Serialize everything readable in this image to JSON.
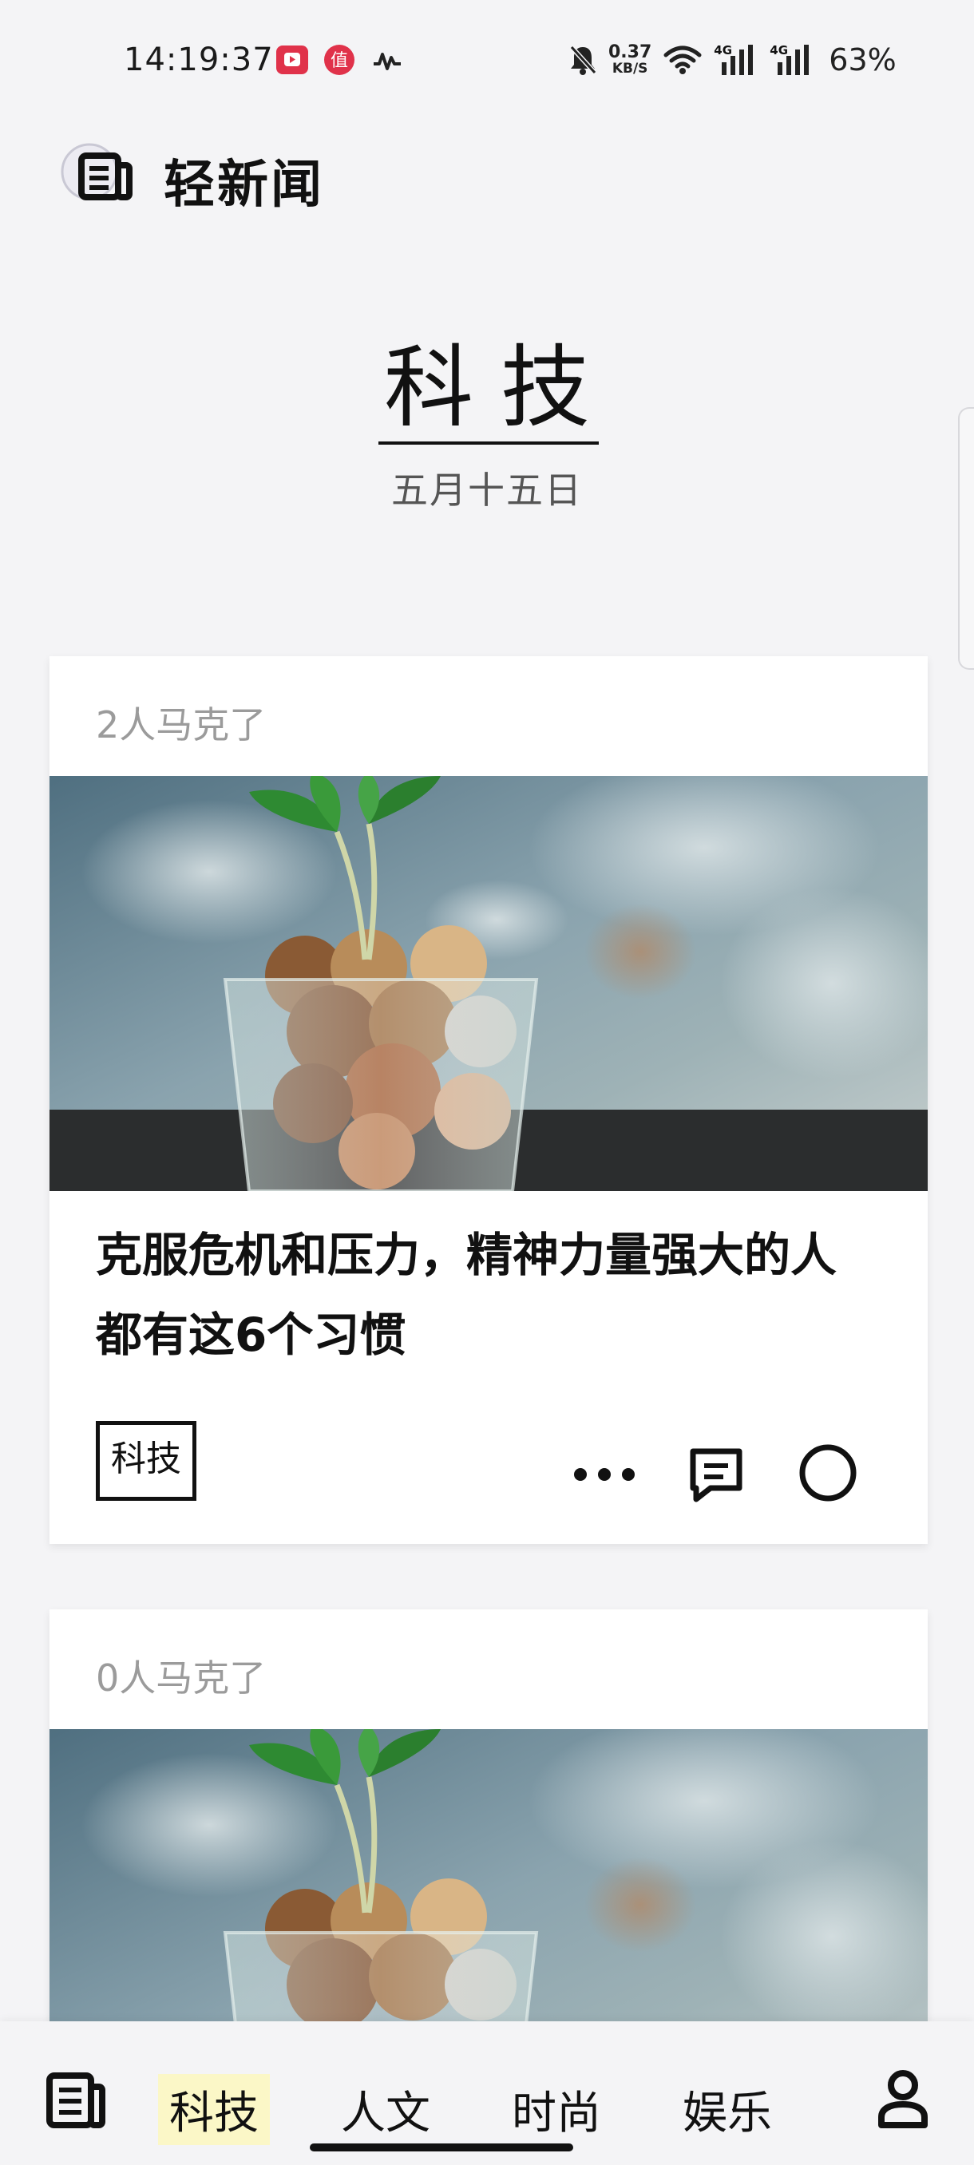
{
  "status_bar": {
    "time": "14:19:37",
    "net_speed_value": "0.37",
    "net_speed_unit": "KB/S",
    "signal1_label": "4G",
    "signal2_label": "4G",
    "battery": "63%",
    "notif_badge_text": "值"
  },
  "app": {
    "title": "轻新闻"
  },
  "section": {
    "title": "科技",
    "date": "五月十五日"
  },
  "articles": [
    {
      "marks": "2人马克了",
      "title": "克服危机和压力，精神力量强大的人都有这6个习惯",
      "tag": "科技"
    },
    {
      "marks": "0人马克了"
    }
  ],
  "bottom_nav": {
    "tabs": [
      {
        "label": "科技",
        "active": true
      },
      {
        "label": "人文",
        "active": false
      },
      {
        "label": "时尚",
        "active": false
      },
      {
        "label": "娱乐",
        "active": false
      }
    ]
  },
  "icons": {
    "app_logo": "newspaper-icon",
    "more": "more-horizontal-icon",
    "comment": "comment-icon",
    "mark": "circle-icon",
    "nav_home": "newspaper-icon",
    "nav_profile": "user-icon"
  },
  "colors": {
    "background": "#f4f4f6",
    "text": "#111111",
    "muted": "#9b9b9b",
    "active_tab_highlight": "#fbf7c7",
    "notification_red": "#e0324a"
  }
}
